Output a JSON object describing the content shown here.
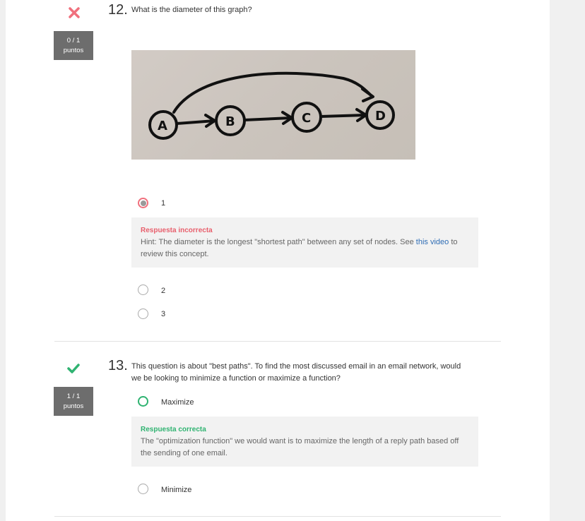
{
  "q12": {
    "number": "12.",
    "text": "What is the diameter of this graph?",
    "score_value": "0 / 1",
    "score_unit": "puntos",
    "status_icon": "cross-icon",
    "status_color": "#f0707d",
    "graph_nodes": [
      "A",
      "B",
      "C",
      "D"
    ],
    "options": [
      {
        "label": "1",
        "state": "selected-wrong"
      },
      {
        "label": "2",
        "state": "unselected"
      },
      {
        "label": "3",
        "state": "unselected"
      }
    ],
    "feedback": {
      "title": "Respuesta incorrecta",
      "text_before": "Hint: The diameter is the longest \"shortest path\" between any set of nodes. See ",
      "link_text": "this video",
      "text_after": " to review this concept."
    }
  },
  "q13": {
    "number": "13.",
    "text": "This question is about \"best paths\". To find the most discussed email in an email network, would we be looking to minimize a function or maximize a function?",
    "score_value": "1 / 1",
    "score_unit": "puntos",
    "status_icon": "check-icon",
    "status_color": "#2fb371",
    "options": [
      {
        "label": "Maximize",
        "state": "selected-correct"
      },
      {
        "label": "Minimize",
        "state": "unselected"
      }
    ],
    "feedback": {
      "title": "Respuesta correcta",
      "text": "The \"optimization function\" we would want is to maximize the length of a reply path based off the sending of one email."
    }
  }
}
